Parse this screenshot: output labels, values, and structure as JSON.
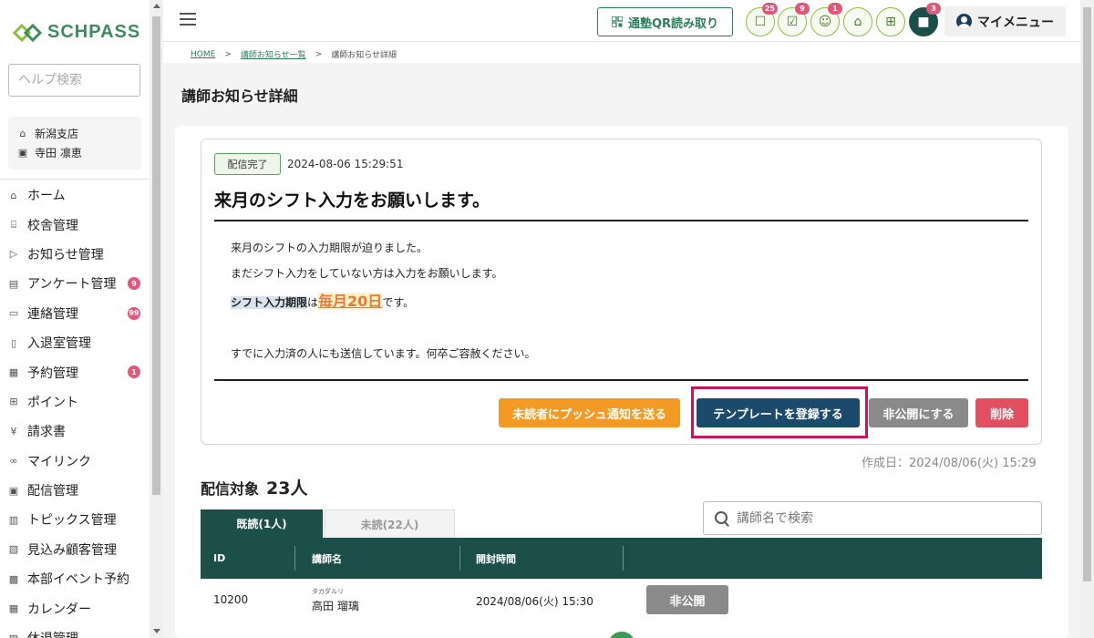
{
  "sidebar": {
    "brand": "SCHPASS",
    "help_search_placeholder": "ヘルプ検索",
    "school": "新潟支店",
    "user": "寺田 凛恵",
    "items": [
      {
        "label": "ホーム",
        "icon": "home-icon",
        "badge": ""
      },
      {
        "label": "校舎管理",
        "icon": "building-icon",
        "badge": ""
      },
      {
        "label": "お知らせ管理",
        "icon": "send-icon",
        "badge": ""
      },
      {
        "label": "アンケート管理",
        "icon": "survey-icon",
        "badge": "9"
      },
      {
        "label": "連絡管理",
        "icon": "chat-icon",
        "badge": "99"
      },
      {
        "label": "入退室管理",
        "icon": "door-icon",
        "badge": ""
      },
      {
        "label": "予約管理",
        "icon": "calendar-icon",
        "badge": "1"
      },
      {
        "label": "ポイント",
        "icon": "gift-icon",
        "badge": ""
      },
      {
        "label": "請求書",
        "icon": "yen-icon",
        "badge": ""
      },
      {
        "label": "マイリンク",
        "icon": "link-icon",
        "badge": ""
      },
      {
        "label": "配信管理",
        "icon": "delivery-icon",
        "badge": ""
      },
      {
        "label": "トピックス管理",
        "icon": "topics-icon",
        "badge": ""
      },
      {
        "label": "見込み顧客管理",
        "icon": "prospect-icon",
        "badge": ""
      },
      {
        "label": "本部イベント予約",
        "icon": "event-icon",
        "badge": ""
      },
      {
        "label": "カレンダー",
        "icon": "calendar-icon",
        "badge": ""
      },
      {
        "label": "休退管理",
        "icon": "leave-icon",
        "badge": ""
      }
    ]
  },
  "header": {
    "qr_label": "通塾QR読み取り",
    "icons": [
      {
        "name": "message-icon",
        "badge": "25",
        "glyph": "☐"
      },
      {
        "name": "checklist-icon",
        "badge": "9",
        "glyph": "☑"
      },
      {
        "name": "people-icon",
        "badge": "1",
        "glyph": "☺"
      },
      {
        "name": "school-icon",
        "badge": "",
        "glyph": "⌂"
      },
      {
        "name": "gift-icon",
        "badge": "",
        "glyph": "⊞"
      },
      {
        "name": "chat-icon",
        "badge": "3",
        "glyph": "■"
      }
    ],
    "my_menu": "マイメニュー"
  },
  "breadcrumb": {
    "home": "HOME",
    "list": "講師お知らせ一覧",
    "current": "講師お知らせ詳細",
    "sep": ">"
  },
  "page": {
    "title": "講師お知らせ詳細"
  },
  "notice": {
    "status": "配信完了",
    "datetime": "2024-08-06 15:29:51",
    "title": "来月のシフト入力をお願いします。",
    "line1": "来月のシフトの入力期限が迫りました。",
    "line2": "まだシフト入力をしていない方は入力をお願いします。",
    "line3_highlight": "シフト入力期限",
    "line3_mid": "は",
    "line3_emph": "毎月20日",
    "line3_end": "です。",
    "line4": "すでに入力済の人にも送信しています。何卒ご容赦ください。",
    "buttons": {
      "push": "未読者にプッシュ通知を送る",
      "template": "テンプレートを登録する",
      "hide": "非公開にする",
      "delete": "削除"
    },
    "created": "作成日：2024/08/06(火) 15:29"
  },
  "targets": {
    "heading": "配信対象",
    "count": "23人",
    "tab_read": "既読(1人)",
    "tab_unread": "未読(22人)",
    "search_placeholder": "講師名で検索",
    "columns": {
      "id": "ID",
      "name": "講師名",
      "opened": "開封時間"
    },
    "rows": [
      {
        "id": "10200",
        "kana": "タカダルリ",
        "name": "高田 瑠璃",
        "opened": "2024/08/06(火) 15:30",
        "action": "非公開"
      }
    ]
  },
  "colors": {
    "brand_green": "#3f8b5f",
    "table_header": "#1c4f4a",
    "push_orange": "#f39a25",
    "template_navy": "#1c4a6a",
    "delete_red": "#e0505e",
    "highlight_frame": "#c0185c"
  }
}
